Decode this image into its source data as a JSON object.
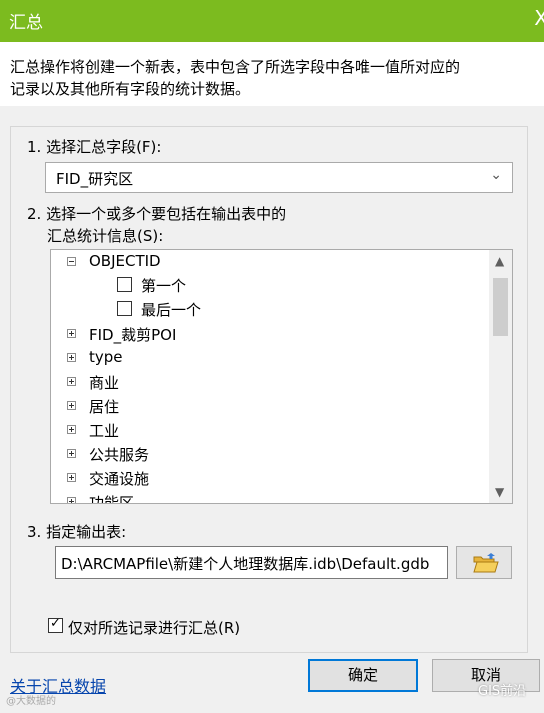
{
  "window": {
    "title": "汇总",
    "close_glyph": "X"
  },
  "description": {
    "line1": "汇总操作将创建一个新表，表中包含了所选字段中各唯一值所对应的",
    "line2": "记录以及其他所有字段的统计数据。"
  },
  "step1": {
    "label": "1. 选择汇总字段(F):",
    "selected": "FID_研究区"
  },
  "step2": {
    "label_line1": "2. 选择一个或多个要包括在输出表中的",
    "label_line2": "汇总统计信息(S):",
    "tree": [
      {
        "label": "OBJECTID",
        "expanded": true
      },
      {
        "child": "第一个",
        "checked": false
      },
      {
        "child": "最后一个",
        "checked": false
      },
      {
        "label": "FID_裁剪POI",
        "expanded": false
      },
      {
        "label": "type",
        "expanded": false
      },
      {
        "label": "商业",
        "expanded": false
      },
      {
        "label": "居住",
        "expanded": false
      },
      {
        "label": "工业",
        "expanded": false
      },
      {
        "label": "公共服务",
        "expanded": false
      },
      {
        "label": "交通设施",
        "expanded": false
      },
      {
        "label": "功能区",
        "expanded": false
      }
    ]
  },
  "step3": {
    "label": "3. 指定输出表:",
    "path": "D:\\ARCMAPfile\\新建个人地理数据库.idb\\Default.gdb"
  },
  "selected_only": {
    "label": "仅对所选记录进行汇总(R)",
    "checked": true
  },
  "help_link": "关于汇总数据",
  "buttons": {
    "ok": "确定",
    "cancel": "取消"
  },
  "watermark": {
    "left": "@大数据的",
    "right": "GIS前沿"
  },
  "colors": {
    "titlebar": "#7cbb1f",
    "accent": "#0078d7"
  }
}
